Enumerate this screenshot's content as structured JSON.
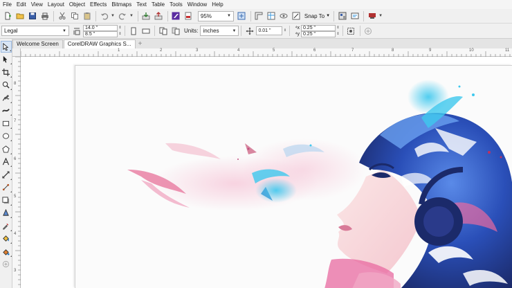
{
  "menu": [
    "File",
    "Edit",
    "View",
    "Layout",
    "Object",
    "Effects",
    "Bitmaps",
    "Text",
    "Table",
    "Tools",
    "Window",
    "Help"
  ],
  "standard_toolbar": {
    "zoom_level": "95%",
    "snap_to_label": "Snap To",
    "icons": [
      "new-icon",
      "open-icon",
      "save-icon",
      "print-icon",
      "cut-icon",
      "copy-icon",
      "paste-icon",
      "undo-icon",
      "redo-icon",
      "import-icon",
      "export-icon",
      "publish-icon",
      "zoom-fit-icon",
      "full-screen-icon",
      "rulers-icon",
      "guidelines-icon",
      "launch-icon",
      "options-icon"
    ]
  },
  "property_bar": {
    "page_size": "Legal",
    "width": "14.0 \"",
    "height": "8.5 \"",
    "units_label": "Units:",
    "units_value": "inches",
    "nudge": "0.01 \"",
    "duplicate_x": "0.25 \"",
    "duplicate_y": "0.25 \""
  },
  "tabs": [
    {
      "label": "Welcome Screen",
      "active": false
    },
    {
      "label": "CorelDRAW Graphics S...",
      "active": true
    }
  ],
  "toolbox": [
    "pick-tool-icon",
    "shape-tool-icon",
    "crop-tool-icon",
    "zoom-tool-icon",
    "freehand-tool-icon",
    "artistic-media-icon",
    "rectangle-tool-icon",
    "ellipse-tool-icon",
    "polygon-tool-icon",
    "text-tool-icon",
    "parallel-dimension-icon",
    "connector-tool-icon",
    "drop-shadow-icon",
    "transparency-tool-icon",
    "color-eyedropper-icon",
    "interactive-fill-icon",
    "smart-fill-icon",
    "add-tool-icon"
  ],
  "ruler": {
    "h_labels": [
      "",
      "1",
      "2",
      "3",
      "4",
      "5",
      "6",
      "7",
      "8",
      "9",
      "10",
      "11"
    ],
    "v_labels": [
      "8",
      "7",
      "6",
      "5",
      "4",
      "3",
      "2"
    ]
  },
  "colors": {
    "accent_purple": "#5a2ca0",
    "art_blue": "#2a5fc8",
    "art_cyan": "#3ec8ee",
    "art_pink": "#e86aa0",
    "art_navy": "#1b2a6a"
  }
}
